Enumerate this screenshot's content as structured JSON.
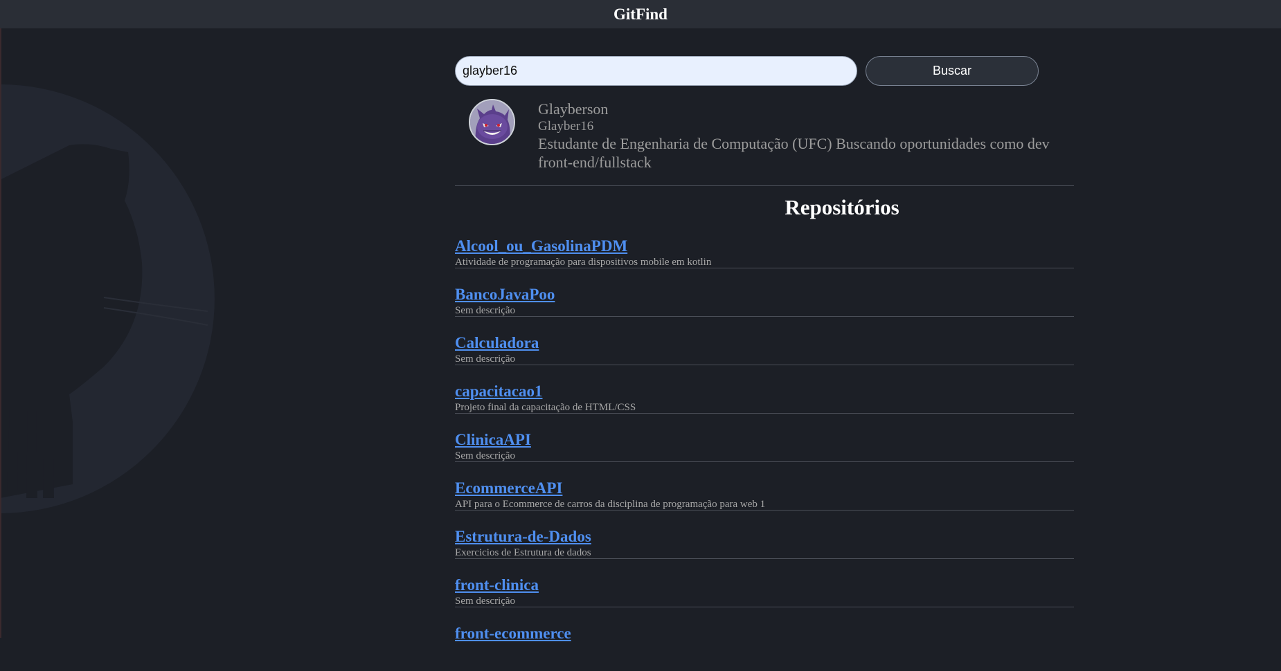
{
  "app": {
    "title": "GitFind"
  },
  "search": {
    "value": "glayber16",
    "button_label": "Buscar"
  },
  "profile": {
    "name": "Glayberson",
    "login": "Glayber16",
    "bio": "Estudante de Engenharia de Computação (UFC) Buscando oportunidades como dev front-end/fullstack"
  },
  "repositories": {
    "heading": "Repositórios",
    "items": [
      {
        "name": "Alcool_ou_GasolinaPDM",
        "description": "Atividade de programação para dispositivos mobile em kotlin"
      },
      {
        "name": "BancoJavaPoo",
        "description": "Sem descrição"
      },
      {
        "name": "Calculadora",
        "description": "Sem descrição"
      },
      {
        "name": "capacitacao1",
        "description": "Projeto final da capacitação de HTML/CSS"
      },
      {
        "name": "ClinicaAPI",
        "description": "Sem descrição"
      },
      {
        "name": "EcommerceAPI",
        "description": "API para o Ecommerce de carros da disciplina de programação para web 1"
      },
      {
        "name": "Estrutura-de-Dados",
        "description": "Exercicios de Estrutura de dados"
      },
      {
        "name": "front-clinica",
        "description": "Sem descrição"
      },
      {
        "name": "front-ecommerce",
        "description": ""
      }
    ]
  },
  "colors": {
    "background": "#1c1f26",
    "topbar": "#2a2e36",
    "link": "#4f8ff0",
    "muted_text": "#9c9c9c"
  },
  "icons": {
    "background_logo": "github-octocat-icon",
    "avatar": "gengar-avatar"
  }
}
